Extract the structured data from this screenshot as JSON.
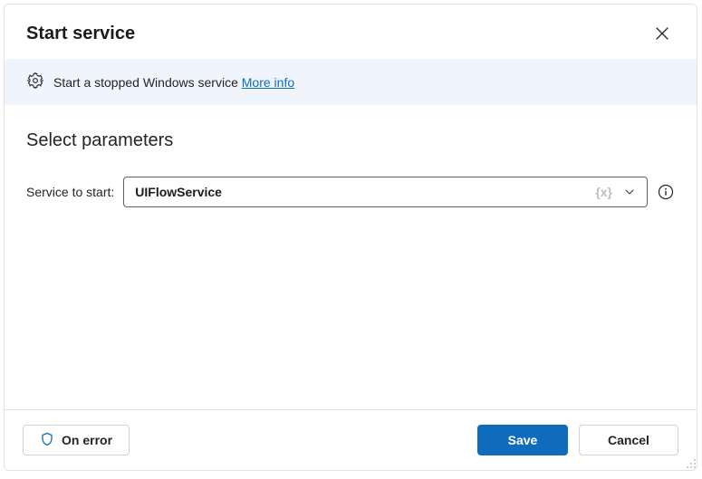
{
  "header": {
    "title": "Start service"
  },
  "info": {
    "text": "Start a stopped Windows service ",
    "moreInfo": "More info"
  },
  "params": {
    "sectionTitle": "Select parameters",
    "serviceLabel": "Service to start:",
    "serviceValue": "UIFlowService",
    "varToken": "{x}"
  },
  "footer": {
    "onError": "On error",
    "save": "Save",
    "cancel": "Cancel"
  }
}
